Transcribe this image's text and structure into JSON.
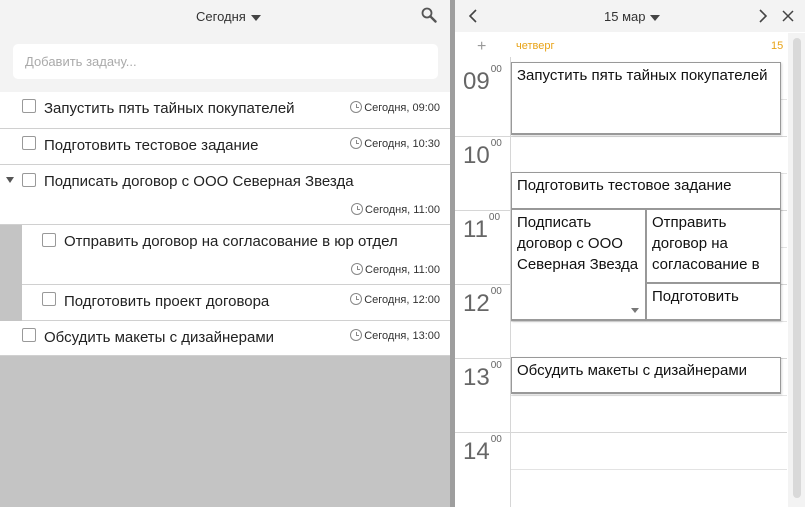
{
  "tasks_panel": {
    "filter_label": "Сегодня",
    "add_placeholder": "Добавить задачу...",
    "tasks": [
      {
        "title": "Запустить пять тайных покупателей",
        "time": "Сегодня, 09:00"
      },
      {
        "title": "Подготовить тестовое задание",
        "time": "Сегодня, 10:30"
      },
      {
        "title": "Подписать договор с ООО Северная Звезда",
        "time": "Сегодня, 11:00"
      },
      {
        "title": "Отправить договор на согласование в юр отдел",
        "time": "Сегодня, 11:00"
      },
      {
        "title": "Подготовить проект договора",
        "time": "Сегодня, 12:00"
      },
      {
        "title": "Обсудить макеты с дизайнерами",
        "time": "Сегодня, 13:00"
      }
    ]
  },
  "calendar": {
    "date_label": "15 мар",
    "day_name": "четверг",
    "day_number": "15",
    "add_label": "+",
    "hours": [
      {
        "hour": "09",
        "minutes": "00"
      },
      {
        "hour": "10",
        "minutes": "00"
      },
      {
        "hour": "11",
        "minutes": "00"
      },
      {
        "hour": "12",
        "minutes": "00"
      },
      {
        "hour": "13",
        "minutes": "00"
      },
      {
        "hour": "14",
        "minutes": "00"
      }
    ],
    "events": [
      {
        "title": "Запустить пять тайных покупателей"
      },
      {
        "title": "Подготовить тестовое задание"
      },
      {
        "title": "Подписать договор с ООО Северная Звезда"
      },
      {
        "title": "Отправить договор на согласование в"
      },
      {
        "title": "Подготовить"
      },
      {
        "title": "Обсудить макеты с дизайнерами"
      }
    ]
  },
  "colors": {
    "accent": "#e8a317",
    "panel_bg": "#c4c4c4",
    "header_bg": "#f3f3f3"
  }
}
